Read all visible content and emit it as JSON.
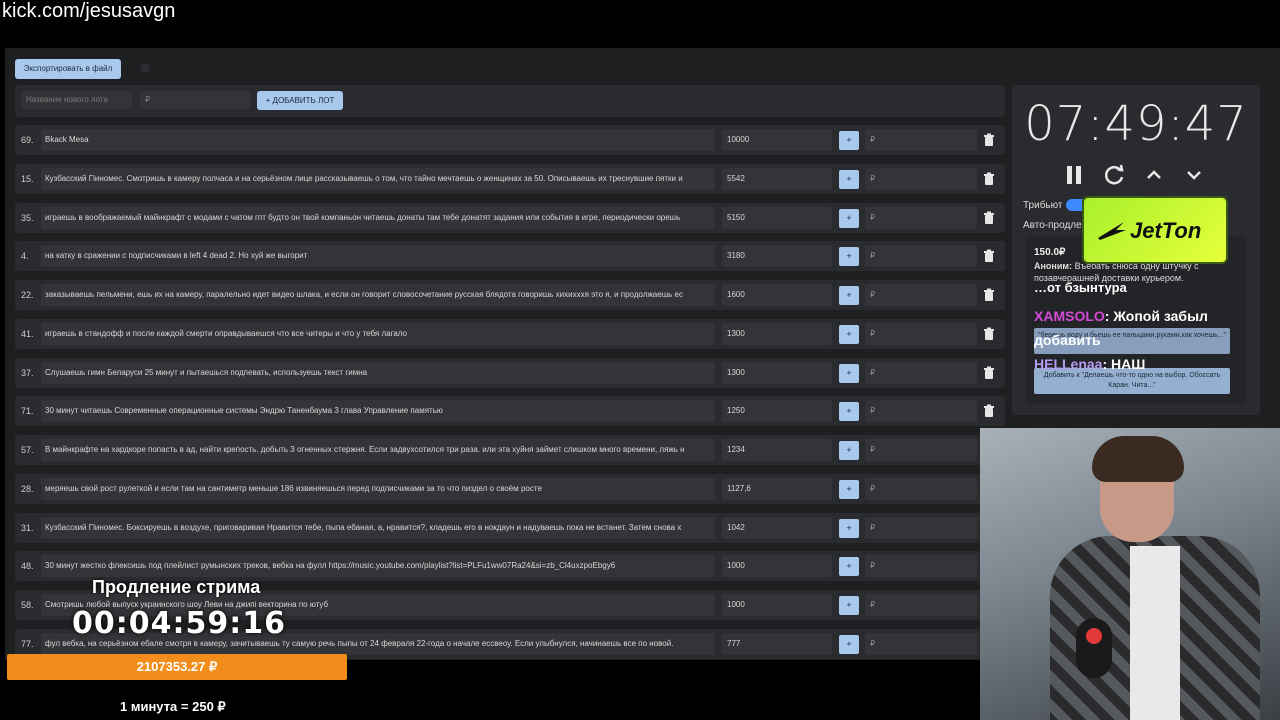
{
  "url": "kick.com/jesusavgn",
  "toolbar": {
    "export_label": "Экспортировать в файл"
  },
  "add_lot": {
    "name_placeholder": "Название нового лота",
    "price_placeholder": "₽",
    "button_label": "+ ДОБАВИТЬ ЛОТ"
  },
  "lots": [
    {
      "num": "69.",
      "text": "Bkack Mesa",
      "amount": "10000"
    },
    {
      "num": "15.",
      "text": "Кузбасский Гlиномес. Смотришь в камеру полчаса и на серьёзном лице рассказываешь о том, что тайно мечтаешь о женщинах за 50. Описываешь их треснувшие пятки и",
      "amount": "5542"
    },
    {
      "num": "35.",
      "text": "играешь в воображаемый майнкрафт с модами с чатом гпт будто он твой компаньон читаешь донаты там тебе донатят задания или события в игре, периодически орешь",
      "amount": "5150"
    },
    {
      "num": "4.",
      "text": "на катку в сражении с подписчиками в left 4 dead 2. Но хуй же выгорит",
      "amount": "3180"
    },
    {
      "num": "22.",
      "text": "заказываешь пельмени, ешь их на камеру, паралельно идет видео шлака, и если он говорит словосочетание русская блядота говоришь хихихххя это я, и продолжаешь ес",
      "amount": "1600"
    },
    {
      "num": "41.",
      "text": "играешь в стандофф и после каждой смерти оправдываешся что все читеры и что у тебя лагало",
      "amount": "1300"
    },
    {
      "num": "37.",
      "text": "Слушаешь гимн Беларуси 25 минут и пытаешься подпевать, используешь текст гимна",
      "amount": "1300"
    },
    {
      "num": "71.",
      "text": "30 минут читаешь Современные операционные системы Эндрю Таненбаума 3 глава Управление памятью",
      "amount": "1250"
    },
    {
      "num": "57.",
      "text": "В майнкрафте на хардкоре попасть в ад, найти крепость. добыть 3 огненных стержня. Если задвухсотился три раза. или эта хуйня займет слишком много времени, ляжь н",
      "amount": "1234"
    },
    {
      "num": "28.",
      "text": "меряешь свой рост рулеткой и если там на сантиметр меньше 186 извиняешься перед подписчиками за то что пиздел о своём росте",
      "amount": "1127,6"
    },
    {
      "num": "31.",
      "text": "Кузбасский Гlиномес. Боксируешь в воздухе, приговаривая Нравится тебе, пыпа ебаная, а, нравится?, кладешь его в нокдаун и надуваешь пока не встанет. Затем снова х",
      "amount": "1042"
    },
    {
      "num": "48.",
      "text": "30 минут жестко флексишь под плейлист румынских треков, вебка на фулл https://music.youtube.com/playlist?list=PLFu1ww07Ra24&si=zb_Cl4uxzpoEbgy6",
      "amount": "1000"
    },
    {
      "num": "58.",
      "text": "Смотришь любой выпуск украинского шоу Леви на джипі векторина по ютуб",
      "amount": "1000"
    },
    {
      "num": "77.",
      "text": "фул вебка, на серьёзном ебале смотря в камеру, зачитываешь ту самую речь пыпы от 24 февраля 22-года о начале есcвеоу. Если улыбнулся, начинаешь все по новой.",
      "amount": "777"
    }
  ],
  "row_plus": "+",
  "row_currency": "₽",
  "sidebar": {
    "timer": "07:49:47",
    "tribut_label": "Трибьют",
    "auto_label": "Авто-продле",
    "jetton": "JetTon",
    "donation": {
      "amount": "150.0₽",
      "author": "Аноним:",
      "text": "Въебать снюса одну штучку с позавчерашней доставки курьером."
    },
    "partial_line": "…от бзынтура",
    "chat1": {
      "name": "XAMSOLO",
      "text": ": Жопой забыл добавить"
    },
    "chat2": {
      "name": "HELLenaa",
      "text": ": НАШ"
    },
    "overlay1": "\"берешь воду и бьешь ее пальцами,руками,как хочешь...\"",
    "overlay2": "Добавить к \"Делаешь что-то одно на выбор. Обоссать Каран. Чита...\""
  },
  "overlay": {
    "title": "Продление стрима",
    "timer": "00:04:59:16",
    "total": "2107353.27 ₽",
    "rate": "1 минута = 250 ₽"
  },
  "colors": {
    "accent": "#a9c8ee",
    "bar": "#f28c1a",
    "panel": "#2a2b2e"
  }
}
